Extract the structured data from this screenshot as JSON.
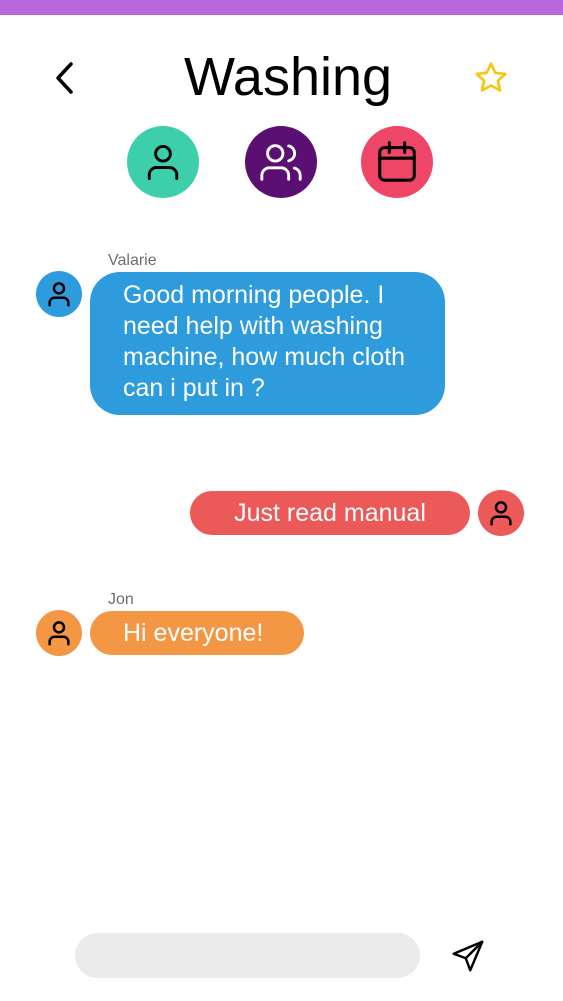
{
  "header": {
    "title": "Washing",
    "back_icon": "chevron-left-icon",
    "favorite_icon": "star-icon",
    "colors": {
      "top_bar": "#b868dc",
      "star": "#f5c518"
    }
  },
  "actions": [
    {
      "icon": "user-icon",
      "color": "#3dcfab"
    },
    {
      "icon": "users-icon",
      "color": "#5c0f73"
    },
    {
      "icon": "calendar-icon",
      "color": "#ef4667"
    }
  ],
  "messages": [
    {
      "sender": "Valarie",
      "text": "Good morning people. I need help with washing machine, how much cloth can i put in ?",
      "side": "left",
      "color": "#2d9bdc"
    },
    {
      "sender": "",
      "text": "Just read manual",
      "side": "right",
      "color": "#eb5959"
    },
    {
      "sender": "Jon",
      "text": "Hi everyone!",
      "side": "left",
      "color": "#f39745"
    }
  ],
  "composer": {
    "placeholder": "",
    "send_icon": "send-icon"
  }
}
